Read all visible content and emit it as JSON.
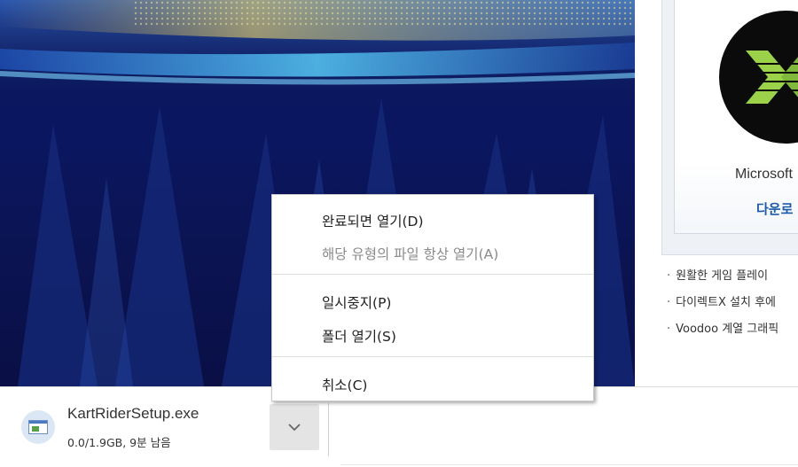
{
  "side_panel": {
    "product_label": "Microsoft",
    "download_label": "다운로",
    "notes": [
      "원활한 게임 플레이",
      "다이렉트X 설치 후에",
      "Voodoo 계열 그래픽"
    ]
  },
  "context_menu": {
    "items": [
      {
        "label": "완료되면 열기(D)",
        "enabled": true
      },
      {
        "label": "해당 유형의 파일 항상 열기(A)",
        "enabled": false
      },
      {
        "label": "일시중지(P)",
        "enabled": true
      },
      {
        "label": "폴더 열기(S)",
        "enabled": true
      },
      {
        "label": "취소(C)",
        "enabled": true
      }
    ]
  },
  "download_shelf": {
    "file_name": "KartRiderSetup.exe",
    "status": "0.0/1.9GB, 9분 남음",
    "file_icon": "application-window-icon",
    "menu_icon": "chevron-down-icon"
  },
  "colors": {
    "banner_dark": "#0b1454",
    "banner_accent": "#3aa6e6",
    "link_blue": "#1d5aa8",
    "dx_green": "#9bd24a"
  }
}
